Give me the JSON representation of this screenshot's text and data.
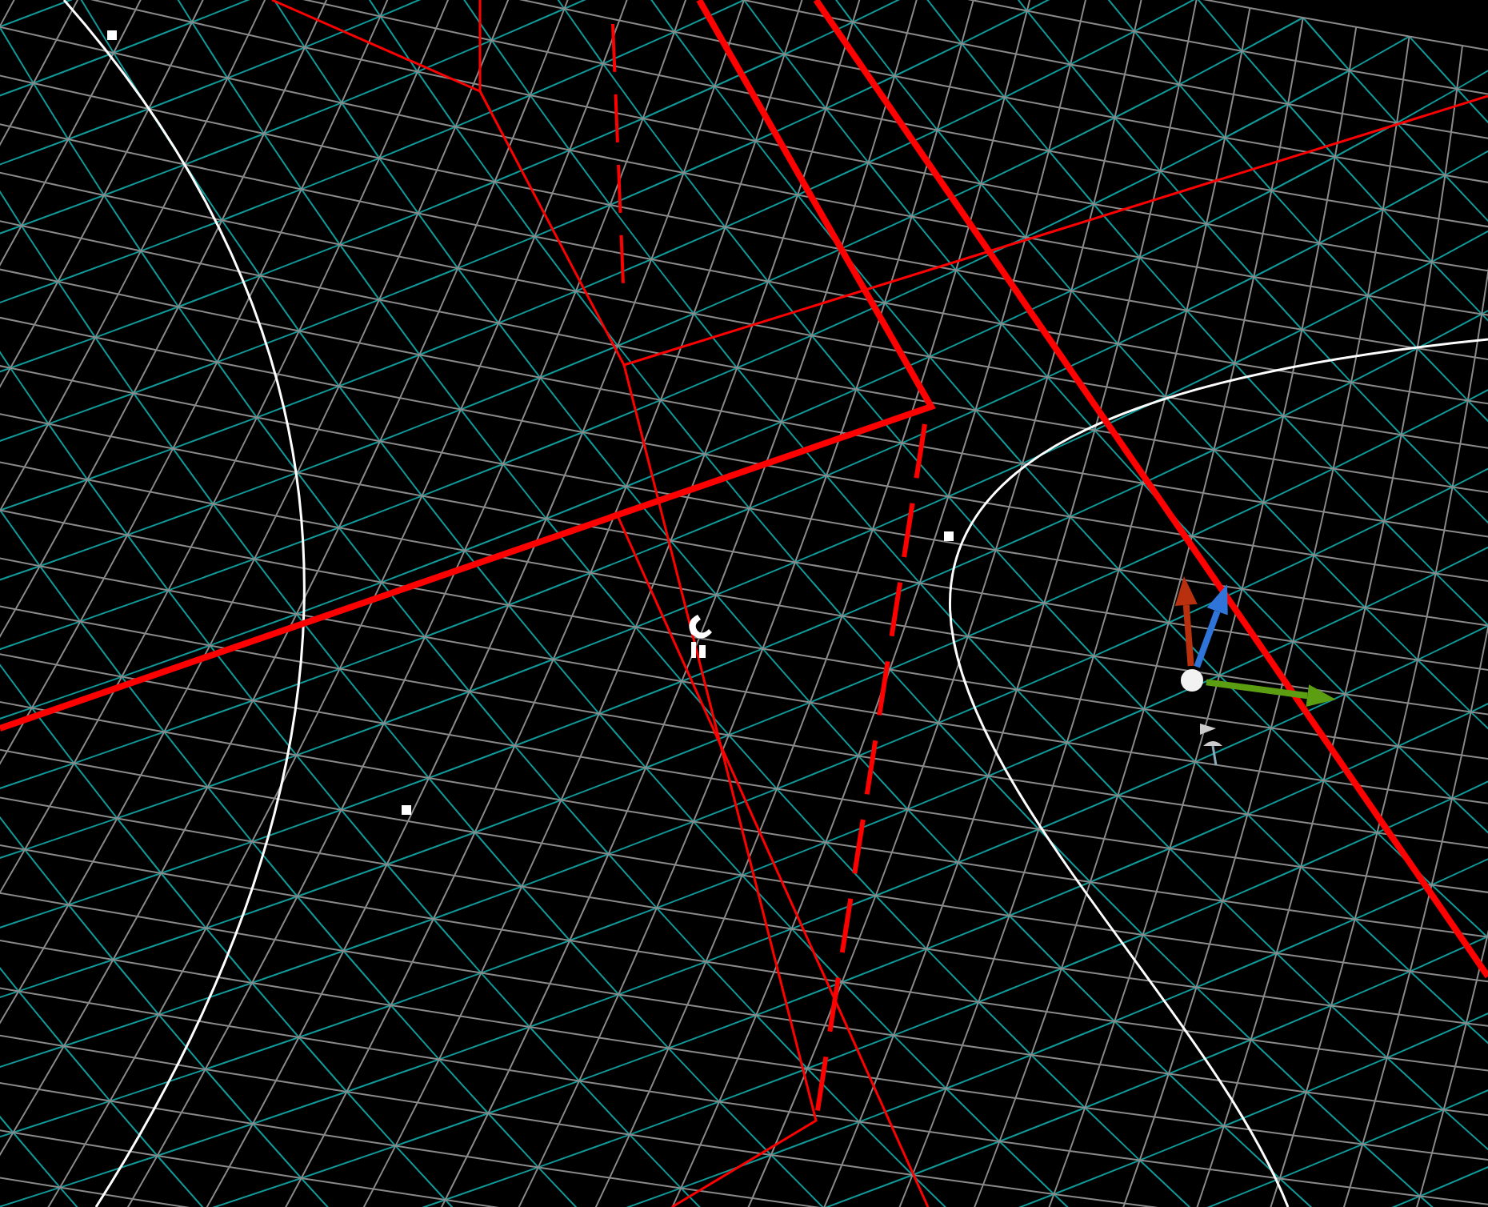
{
  "viewport": {
    "kind": "wireframe"
  },
  "gizmo": {
    "axes": [
      {
        "kind": "up",
        "color": "#b8300e"
      },
      {
        "kind": "forward",
        "color": "#2f74d8"
      },
      {
        "kind": "right",
        "color": "#5c9e12"
      }
    ]
  }
}
